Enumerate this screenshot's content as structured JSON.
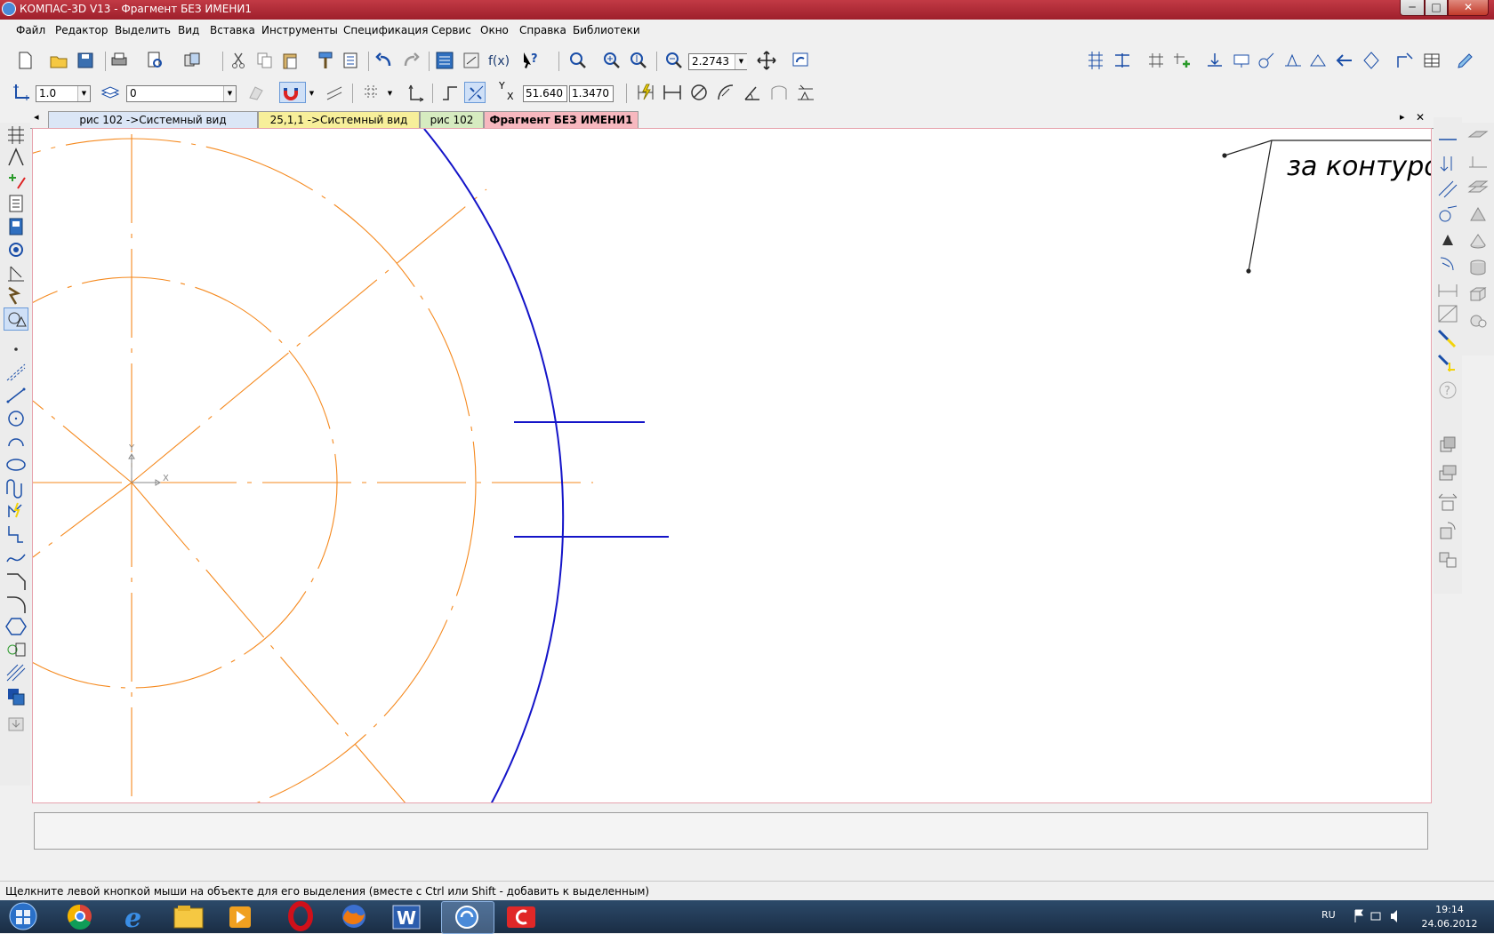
{
  "window": {
    "title": "КОМПАС-3D V13 - Фрагмент БЕЗ ИМЕНИ1",
    "min_glyph": "─",
    "max_glyph": "□",
    "close_glyph": "✕"
  },
  "menu": [
    "Файл",
    "Редактор",
    "Выделить",
    "Вид",
    "Вставка",
    "Инструменты",
    "Спецификация",
    "Сервис",
    "Окно",
    "Справка",
    "Библиотеки"
  ],
  "toolbar": {
    "zoom_value": "2.2743",
    "line_scale": "1.0",
    "layer": "0",
    "coord_label_y": "Y",
    "coord_label_x": "X",
    "coord_x": "51.640",
    "coord_y": "1.3470"
  },
  "tabs": [
    {
      "label": "рис 102 ->Системный вид",
      "color": "#dbe6f6",
      "active": false
    },
    {
      "label": "25,1,1 ->Системный вид",
      "color": "#f7ef9a",
      "active": false
    },
    {
      "label": "рис 102",
      "color": "#d6ebc0",
      "active": false
    },
    {
      "label": "Фрагмент БЕЗ ИМЕНИ1",
      "color": "#f7b8bf",
      "active": true
    }
  ],
  "tab_nav": {
    "left": "◂",
    "right": "▸",
    "close": "✕"
  },
  "canvas": {
    "annotation_text": "за контуро",
    "axis_x_label": "X",
    "axis_y_label": "Y",
    "colors": {
      "axis": "#f5891e",
      "geometry": "#1414c8",
      "leader": "#222222"
    }
  },
  "status_text": "Щелкните левой кнопкой мыши на объекте для его выделения (вместе с Ctrl или Shift - добавить к выделенным)",
  "taskbar": {
    "apps": [
      "start-orb",
      "chrome",
      "internet-explorer",
      "windows-explorer",
      "media-player",
      "opera",
      "firefox",
      "word",
      "kompas-3d",
      "kompas-active"
    ],
    "language": "RU",
    "time": "19:14",
    "date": "24.06.2012"
  }
}
